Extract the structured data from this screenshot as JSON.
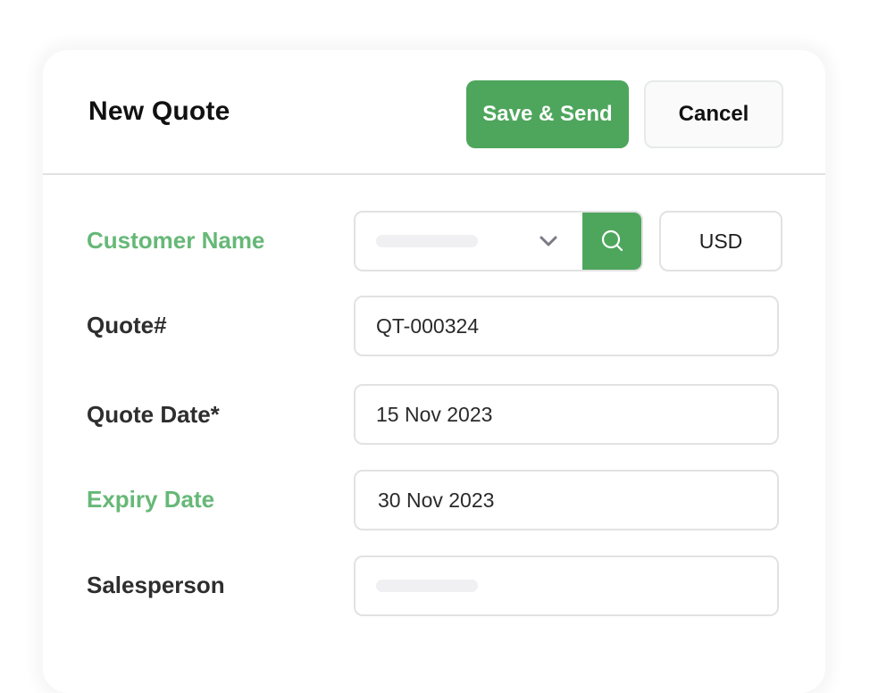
{
  "header": {
    "title": "New Quote",
    "save_send_label": "Save & Send",
    "cancel_label": "Cancel"
  },
  "colors": {
    "accent": "#4ea65c",
    "label_highlight": "#66b877",
    "label_default": "#2e2e2e"
  },
  "form": {
    "customer_name": {
      "label": "Customer Name",
      "value": "",
      "dropdown_icon": "chevron-down-icon",
      "search_icon": "search-icon",
      "currency": "USD"
    },
    "quote_number": {
      "label": "Quote#",
      "value": "QT-000324"
    },
    "quote_date": {
      "label": "Quote Date*",
      "value": "15 Nov 2023"
    },
    "expiry_date": {
      "label": "Expiry Date",
      "value": "30 Nov 2023"
    },
    "salesperson": {
      "label": "Salesperson",
      "value": ""
    }
  }
}
